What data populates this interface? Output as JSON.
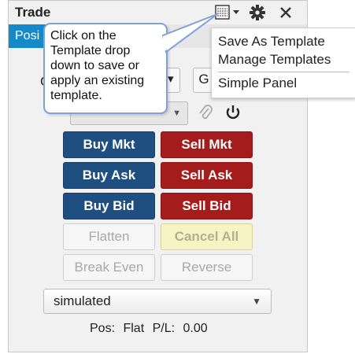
{
  "window": {
    "title": "Trade",
    "template_icon": "template-icon",
    "settings_icon": "gear-icon",
    "close_icon": "close-icon"
  },
  "tabs": [
    {
      "label": "Posi"
    }
  ],
  "partial": {
    "left_letter": "C",
    "right_letter": "G"
  },
  "tooltip": {
    "text_lines": [
      "Click on the",
      "Template drop",
      "down to save or",
      "apply an existing",
      "template."
    ]
  },
  "menu": {
    "items": [
      "Save As Template",
      "Manage Templates",
      "Simple Panel"
    ]
  },
  "buttons": {
    "buy_mkt": "Buy Mkt",
    "sell_mkt": "Sell Mkt",
    "buy_ask": "Buy Ask",
    "sell_ask": "Sell Ask",
    "buy_bid": "Buy Bid",
    "sell_bid": "Sell Bid",
    "flatten": "Flatten",
    "cancel_all": "Cancel All",
    "break_even": "Break Even",
    "reverse": "Reverse"
  },
  "account": {
    "selected": "simulated"
  },
  "status": {
    "pos_label": "Pos:",
    "pos_value": "Flat",
    "pl_label": "P/L:",
    "pl_value": "0.00"
  },
  "colors": {
    "tab_blue": "#1689c9",
    "buy_blue": "#1f4e80",
    "sell_red": "#a51c1c",
    "tooltip_border": "#7fa0d8"
  }
}
